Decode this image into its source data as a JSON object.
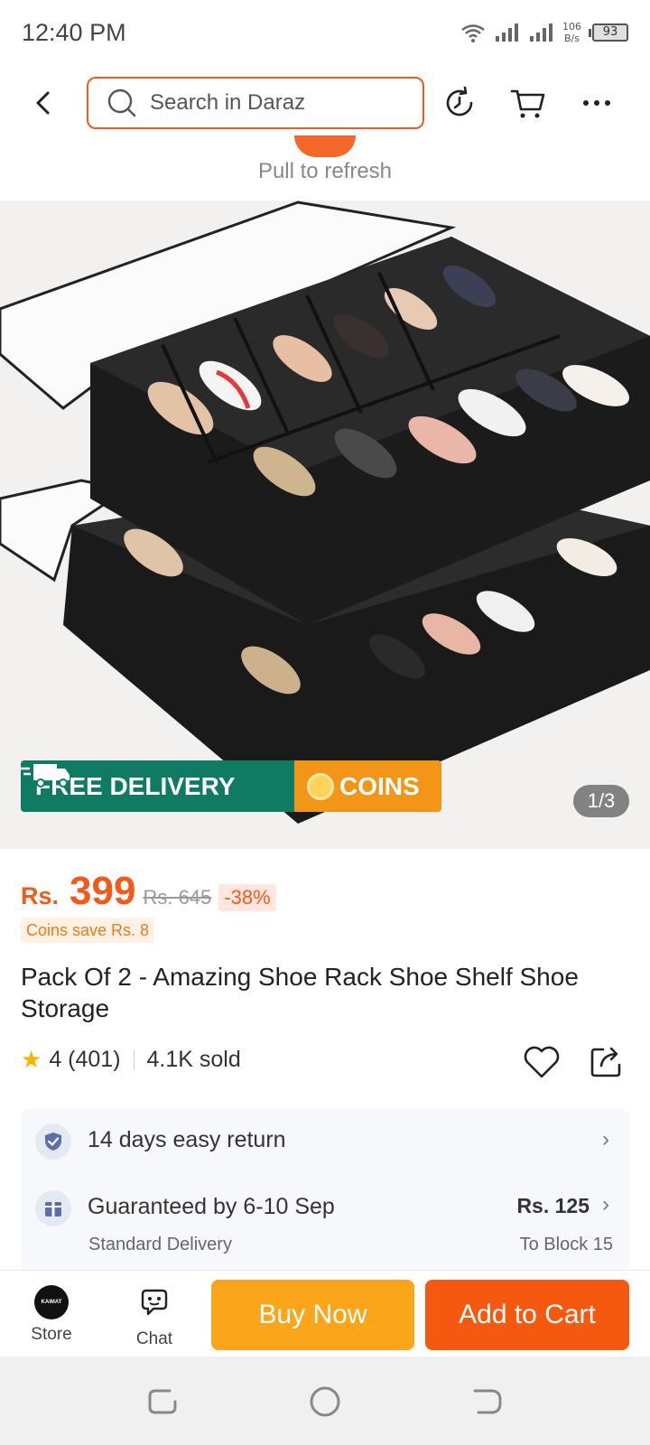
{
  "status_bar": {
    "time": "12:40 PM",
    "net_speed_value": "106",
    "net_speed_unit": "B/s",
    "battery": "93"
  },
  "top_nav": {
    "search_placeholder": "Search in Daraz",
    "icons": [
      "back-icon",
      "search-icon",
      "history-icon",
      "cart-icon",
      "more-icon"
    ]
  },
  "pull_to_refresh": "Pull to refresh",
  "gallery": {
    "badge_free": "FREE DELIVERY",
    "badge_coins": "COINS",
    "indicator": "1/3"
  },
  "product": {
    "currency": "Rs.",
    "price": "399",
    "original_price": "Rs. 645",
    "discount": "-38%",
    "coins_save": "Coins save Rs. 8",
    "title": "Pack Of 2 - Amazing Shoe Rack Shoe Shelf Shoe Storage",
    "rating": "4 (401)",
    "sold": "4.1K sold"
  },
  "services": {
    "return_text": "14 days easy return",
    "delivery_text": "Guaranteed by 6-10 Sep",
    "delivery_sub": "Standard Delivery",
    "delivery_price": "Rs. 125",
    "delivery_dest": "To Block 15"
  },
  "action_bar": {
    "store_label": "Store",
    "chat_label": "Chat",
    "buy_now": "Buy Now",
    "add_to_cart": "Add to Cart"
  },
  "colors": {
    "accent": "#f05a1a",
    "buy_now": "#faa51a",
    "add_to_cart": "#f5590f",
    "free_delivery": "#0f7b63",
    "coins": "#f39516"
  }
}
